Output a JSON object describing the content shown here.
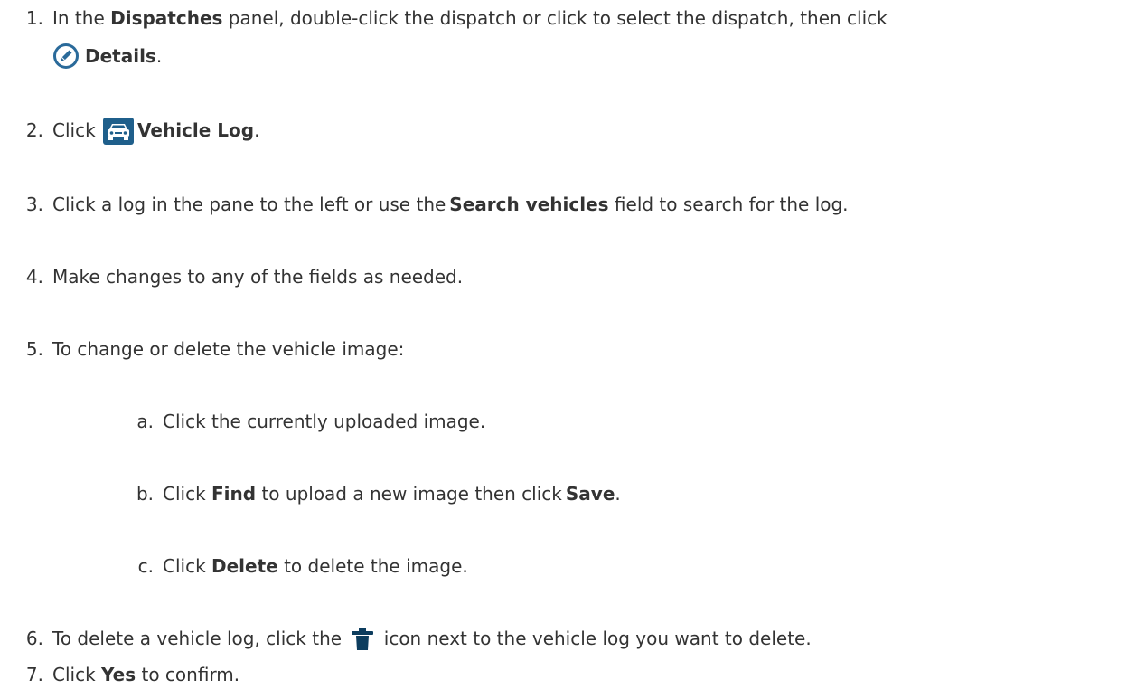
{
  "steps": [
    {
      "num": "1.",
      "pre": "In the ",
      "bold1": "Dispatches",
      "mid": " panel, double-click the dispatch or click to select the dispatch, then click",
      "cont_bold": "Details",
      "cont_post": ".",
      "icon": "pencil-edit-icon"
    },
    {
      "num": "2.",
      "pre": "Click ",
      "bold1": "Vehicle Log",
      "post": ".",
      "icon": "car-icon"
    },
    {
      "num": "3.",
      "pre": "Click a log in the pane to the left or use the",
      "bold1": "Search vehicles",
      "post": " field to search for the log."
    },
    {
      "num": "4.",
      "text": "Make changes to any of the fields as needed."
    },
    {
      "num": "5.",
      "text": "To change or delete the vehicle image:"
    },
    {
      "num": "a.",
      "text": "Click the currently uploaded image."
    },
    {
      "num": "b.",
      "pre": "Click ",
      "bold1": "Find",
      "mid": " to upload a new image then click",
      "bold2": "Save",
      "post": "."
    },
    {
      "num": "c.",
      "pre": "Click ",
      "bold1": "Delete",
      "post": " to delete the image."
    },
    {
      "num": "6.",
      "pre": "To delete a vehicle log, click the ",
      "post": " icon next to the vehicle log you want to delete.",
      "icon": "trash-icon"
    },
    {
      "num": "7.",
      "pre": "Click ",
      "bold1": "Yes",
      "post": " to confirm."
    }
  ],
  "colors": {
    "text": "#333333",
    "icon_blue": "#1f5f8b",
    "icon_dark": "#0d3d5e"
  }
}
